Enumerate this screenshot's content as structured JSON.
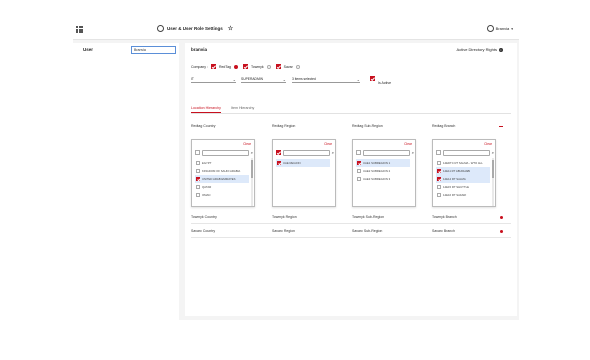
{
  "header": {
    "title": "User & User Role Settings",
    "account_name": "Branvia"
  },
  "left": {
    "user_label": "User",
    "user_value": "Branvia"
  },
  "user_card": {
    "name": "branvia",
    "ad_rights_label": "Active Directory Rights",
    "company_label": "Company :",
    "companies": [
      {
        "name": "RedTag",
        "checked": true,
        "default": true
      },
      {
        "name": "Towmyk",
        "checked": true,
        "default": false
      },
      {
        "name": "Savar",
        "checked": true,
        "default": false
      }
    ],
    "select1": "IT",
    "select2": "SUPERADMIN",
    "select3": "3 items selected",
    "is_active_label": "Is Active"
  },
  "tabs": [
    {
      "label": "Location Hierarchy"
    },
    {
      "label": "Item Hierarchy"
    }
  ],
  "hier": {
    "row1": [
      "Redtag Country",
      "Redtag Region",
      "Redtag Sub-Region",
      "Redtag Branch"
    ],
    "row2": [
      "Towmyk Country",
      "Towmyk Region",
      "Towmyk Sub-Region",
      "Towmyk Branch"
    ],
    "row3": [
      "Savarc Country",
      "Savarc Region",
      "Savarc Sub-Region",
      "Savarc Branch"
    ]
  },
  "dropdowns": [
    {
      "clear": "Clear",
      "options": [
        {
          "label": "EGYPT",
          "checked": false,
          "hl": false
        },
        {
          "label": "KINGDOM OF SAUDI ARABIA",
          "checked": false,
          "hl": false
        },
        {
          "label": "UNITED ARAB EMIRATES",
          "checked": true,
          "hl": true
        },
        {
          "label": "QATAR",
          "checked": false,
          "hl": false
        },
        {
          "label": "OMAN",
          "checked": false,
          "hl": false
        }
      ]
    },
    {
      "clear": "Clear",
      "options": [
        {
          "label": "UAE REGION",
          "checked": true,
          "hl": true
        }
      ]
    },
    {
      "clear": "Clear",
      "options": [
        {
          "label": "UAE1 SUBREGION 1",
          "checked": true,
          "hl": true
        },
        {
          "label": "UAE2 SUBREGION 2",
          "checked": false,
          "hl": false
        },
        {
          "label": "UAE3 SUBREGION 3",
          "checked": false,
          "hl": false
        }
      ]
    },
    {
      "clear": "Clear",
      "options": [
        {
          "label": "14EDTC RT SALMA - WTO ALL",
          "checked": false,
          "hl": false
        },
        {
          "label": "14E11 RT ABUDHABI",
          "checked": true,
          "hl": true
        },
        {
          "label": "14E14 RT SALMA",
          "checked": true,
          "hl": true
        },
        {
          "label": "14E15 RT SHUTTLE",
          "checked": false,
          "hl": false
        },
        {
          "label": "14E16 RT SAFARI",
          "checked": false,
          "hl": false
        }
      ]
    }
  ],
  "colors": {
    "accent": "#c8101e",
    "highlight": "#dde9fa"
  }
}
